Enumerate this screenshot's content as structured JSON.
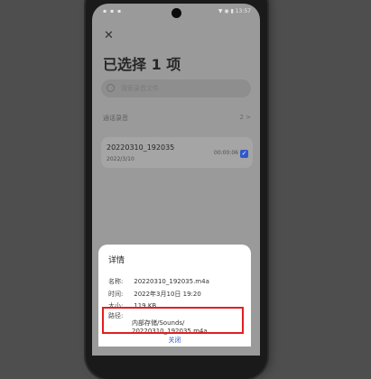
{
  "status": {
    "left_icons": "▪ ▪ ▪",
    "right_text": "▼ ◉ ▮ 13:57"
  },
  "header": {
    "close_icon": "✕",
    "title": "已选择 1 项"
  },
  "search": {
    "placeholder": "搜索录音文件"
  },
  "section": {
    "label": "通话录音",
    "count": "2 >"
  },
  "recording": {
    "name": "20220310_192035",
    "date": "2022/3/10",
    "duration": "00:00:06"
  },
  "details": {
    "heading": "详情",
    "name_label": "名称:",
    "name_value": "20220310_192035.m4a",
    "time_label": "时间:",
    "time_value": "2022年3月10日 19:20",
    "size_label": "大小:",
    "size_value": "119 KB",
    "path_label": "路径:",
    "path_line1": "内部存储/Sounds/",
    "path_line2": "20220310_192035.m4a",
    "close_label": "关闭"
  },
  "colors": {
    "accent": "#2f59c9",
    "highlight": "#e02020"
  }
}
